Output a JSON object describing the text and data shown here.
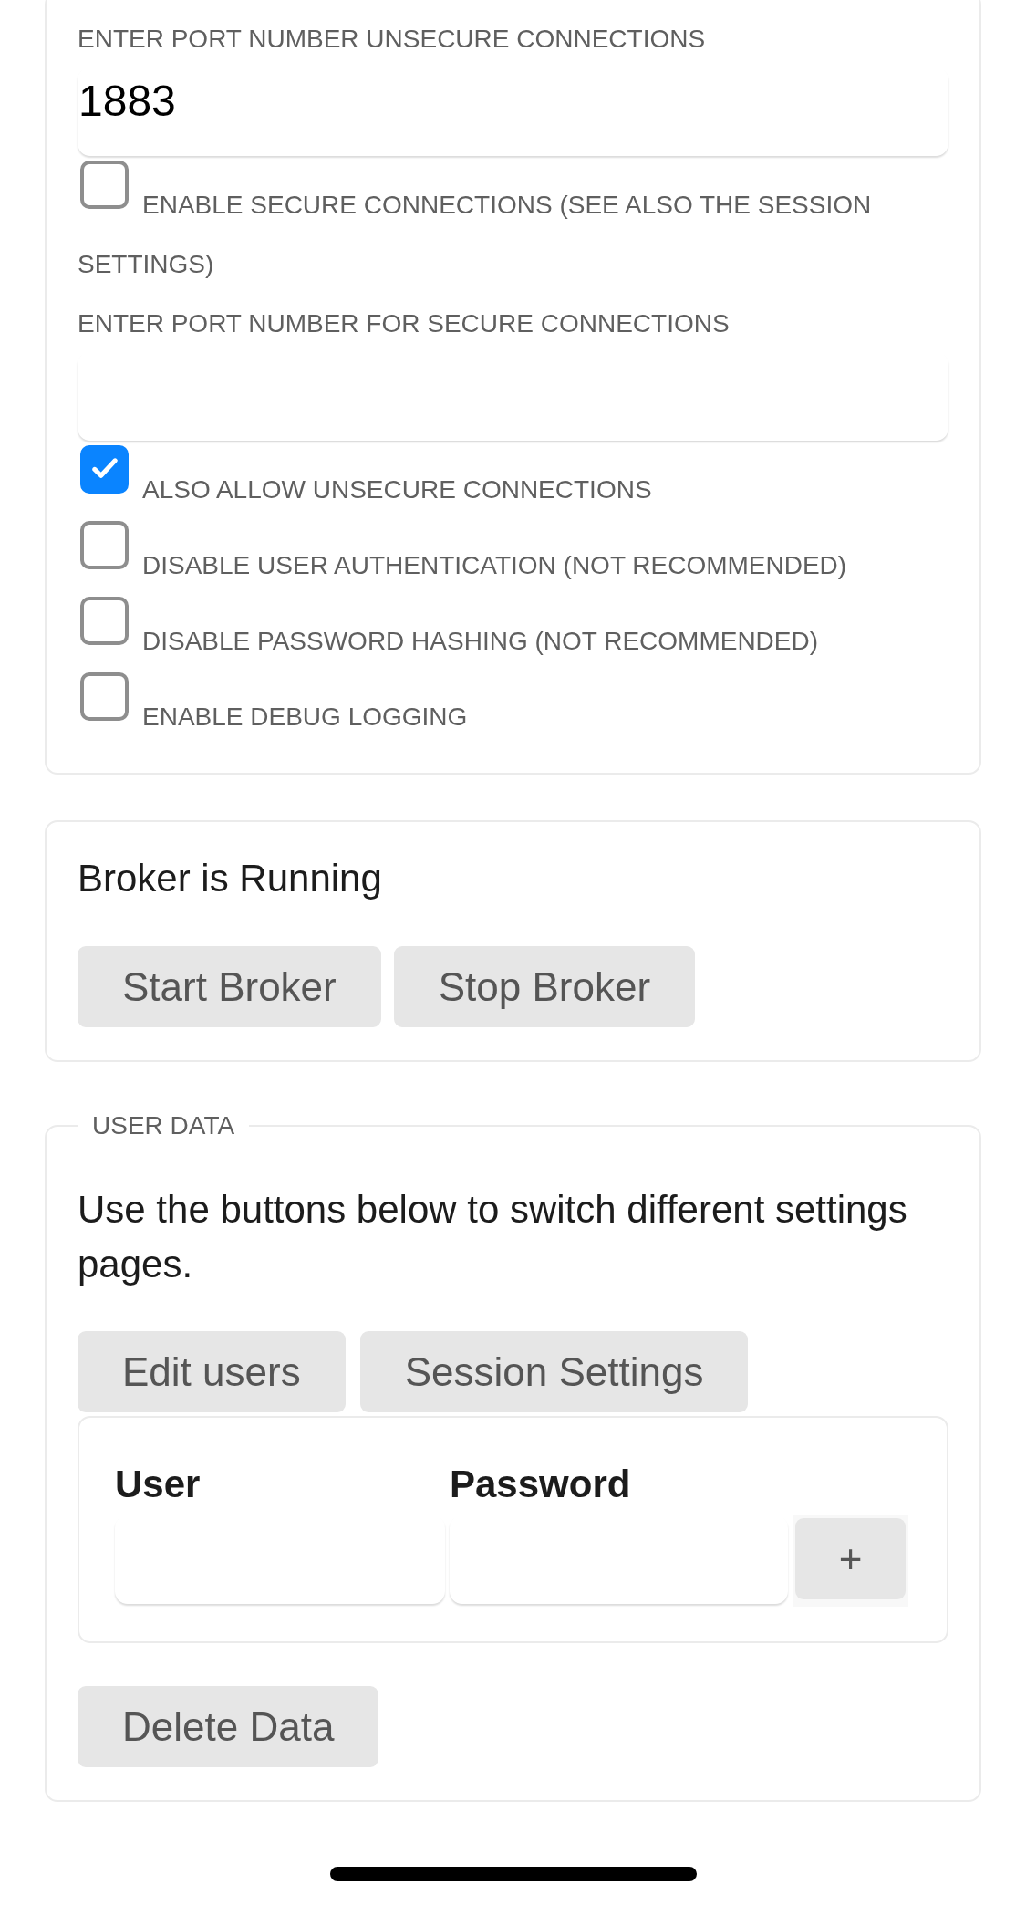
{
  "broker_settings": {
    "items": [
      {
        "kind": "field",
        "label": "ENTER PORT NUMBER UNSECURE CONNECTIONS",
        "value": "1883"
      },
      {
        "kind": "checkbox",
        "label": "ENABLE SECURE CONNECTIONS (SEE ALSO THE SESSION SETTINGS)",
        "checked": false
      },
      {
        "kind": "field",
        "label": "ENTER PORT NUMBER FOR SECURE CONNECTIONS"
      },
      {
        "kind": "checkbox",
        "label": "ALSO ALLOW UNSECURE CONNECTIONS",
        "checked": true
      },
      {
        "kind": "checkbox",
        "label": "DISABLE USER AUTHENTICATION (NOT RECOMMENDED)",
        "checked": false
      },
      {
        "kind": "checkbox",
        "label": "DISABLE PASSWORD HASHING (NOT RECOMMENDED)",
        "checked": false
      },
      {
        "kind": "checkbox",
        "label": "ENABLE DEBUG LOGGING",
        "checked": false
      }
    ]
  },
  "broker_status": {
    "status": "Broker is Running",
    "buttons": [
      "Start Broker",
      "Stop Broker"
    ]
  },
  "user_data": {
    "legend": "USER DATA",
    "description": "Use the buttons below to switch different settings pages.",
    "buttons": [
      "Edit users",
      "Session Settings"
    ],
    "users_table": {
      "columns": [
        "User",
        "Password"
      ],
      "add_button": "+"
    },
    "delete_button": "Delete Data"
  }
}
